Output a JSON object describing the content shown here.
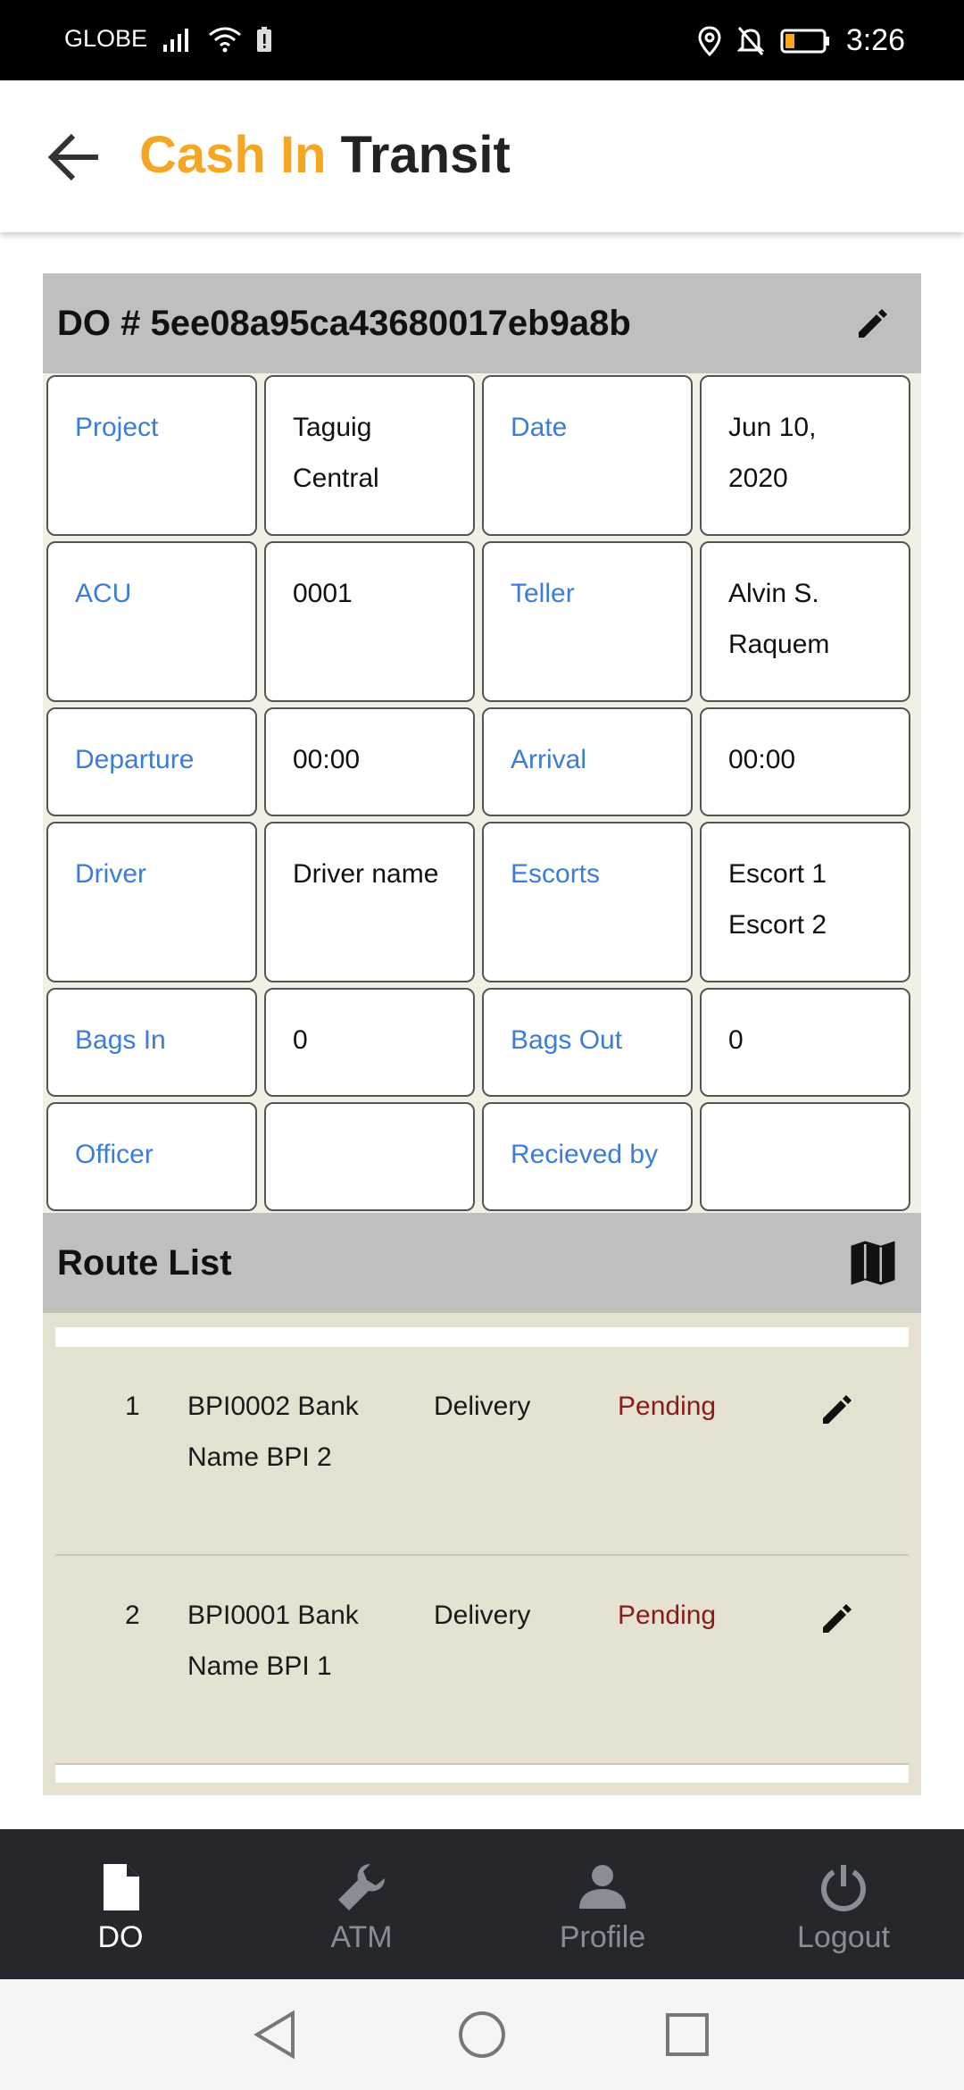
{
  "status_bar": {
    "carrier": "GLOBE",
    "time": "3:26"
  },
  "app_bar": {
    "title_accent": "Cash In",
    "title_main": "Transit"
  },
  "do_section": {
    "title": "DO # 5ee08a95ca43680017eb9a8b"
  },
  "info_rows": [
    {
      "label1": "Project",
      "value1": "Taguig Central",
      "label2": "Date",
      "value2": "Jun 10, 2020"
    },
    {
      "label1": "ACU",
      "value1": "0001",
      "label2": "Teller",
      "value2": "Alvin S. Raquem"
    },
    {
      "label1": "Departure",
      "value1": "00:00",
      "label2": "Arrival",
      "value2": "00:00"
    },
    {
      "label1": "Driver",
      "value1": "Driver name",
      "label2": "Escorts",
      "value2": "Escort 1\nEscort 2"
    },
    {
      "label1": "Bags In",
      "value1": "0",
      "label2": "Bags Out",
      "value2": "0"
    },
    {
      "label1": "Officer",
      "value1": "",
      "label2": "Recieved by",
      "value2": ""
    }
  ],
  "route_list": {
    "title": "Route List",
    "items": [
      {
        "num": "1",
        "bank": "BPI0002 Bank Name BPI 2",
        "type": "Delivery",
        "status": "Pending"
      },
      {
        "num": "2",
        "bank": "BPI0001 Bank Name BPI 1",
        "type": "Delivery",
        "status": "Pending"
      }
    ]
  },
  "bottom_nav": {
    "items": [
      {
        "label": "DO",
        "icon": "document-icon",
        "active": true
      },
      {
        "label": "ATM",
        "icon": "wrench-icon",
        "active": false
      },
      {
        "label": "Profile",
        "icon": "person-icon",
        "active": false
      },
      {
        "label": "Logout",
        "icon": "power-icon",
        "active": false
      }
    ]
  },
  "colors": {
    "accent": "#f5a623",
    "label_blue": "#3b7dd8",
    "status_pending": "#8b1a1a",
    "header_gray": "#bfbfbf",
    "route_bg": "#e5e2d1",
    "nav_bg": "#25272c"
  }
}
